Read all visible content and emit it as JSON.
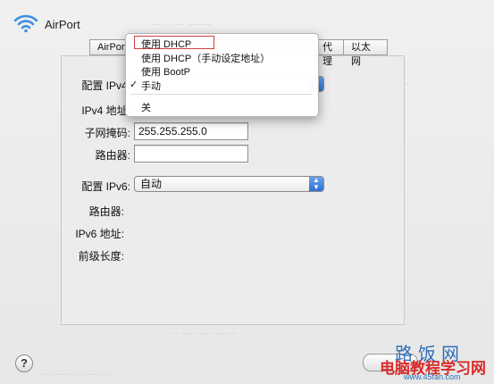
{
  "window": {
    "title": "AirPort"
  },
  "tabs": [
    {
      "label": "AirPort"
    },
    {
      "label": "代理"
    },
    {
      "label": "以太网"
    }
  ],
  "ipv4": {
    "config_label": "配置 IPv4:",
    "address_label": "IPv4 地址:",
    "subnet_label": "子网掩码:",
    "subnet_value": "255.255.255.0",
    "router_label": "路由器:",
    "router_value": ""
  },
  "ipv6": {
    "config_label": "配置 IPv6:",
    "config_value": "自动",
    "router_label": "路由器:",
    "address_label": "IPv6 地址:",
    "prefix_label": "前级长度:"
  },
  "ipv4_menu": {
    "items": [
      {
        "label": "使用 DHCP",
        "checked": false,
        "highlighted": true
      },
      {
        "label": "使用 DHCP（手动设定地址）",
        "checked": false
      },
      {
        "label": "使用 BootP",
        "checked": false
      },
      {
        "label": "手动",
        "checked": true
      },
      {
        "label": "关",
        "checked": false
      }
    ],
    "check_glyph": "✓"
  },
  "bottom": {
    "help_glyph": "?"
  },
  "watermark": {
    "line1": "路饭网",
    "line2": "电脑教程学习网",
    "line3": "www.45fan.com"
  },
  "colors": {
    "menu_highlight_border": "#d04040",
    "watermark_blue": "#2e6eb8",
    "watermark_red": "#d92b2b",
    "popup_arrow": "#2d6fd4"
  },
  "icons": {
    "wifi": "wifi-icon",
    "help": "help-icon",
    "popup_arrows": "popup-arrows-icon"
  }
}
